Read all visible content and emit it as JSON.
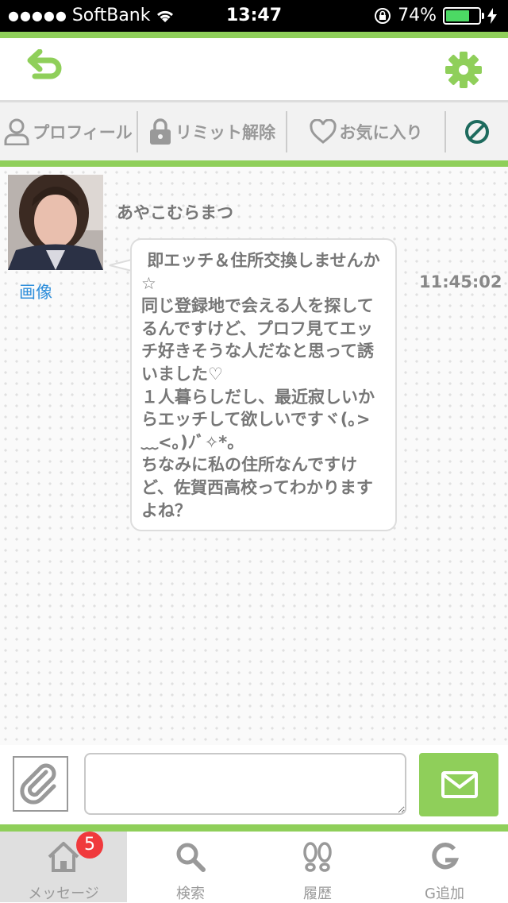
{
  "status_bar": {
    "carrier": "SoftBank",
    "time": "13:47",
    "battery": "74%",
    "battery_level": 0.74
  },
  "toolbar": {
    "profile": "プロフィール",
    "limit_release": "リミット解除",
    "favorite": "お気に入り"
  },
  "chat": {
    "sender_name": "あやこむらまつ",
    "image_link": "画像",
    "message": " 即エッチ＆住所交換しませんか☆\n同じ登録地で会える人を探してるんですけど、プロフ見てエッチ好きそうな人だなと思って誘いました♡\n１人暮らしだし、最近寂しいからエッチして欲しいですヾ(｡>﹏<｡)ﾉﾞ✧*。\nちなみに私の住所なんですけど、佐賀西高校ってわかりますよね？",
    "timestamp": "11:45:02"
  },
  "composer": {
    "value": "",
    "placeholder": ""
  },
  "tabs": [
    {
      "label": "メッセージ",
      "badge": "5"
    },
    {
      "label": "検索"
    },
    {
      "label": "履歴"
    },
    {
      "label": "G追加"
    }
  ],
  "colors": {
    "accent": "#8fcf5a",
    "badge": "#f0393c",
    "link": "#2f8fdb",
    "block_icon": "#1e6b5e"
  }
}
